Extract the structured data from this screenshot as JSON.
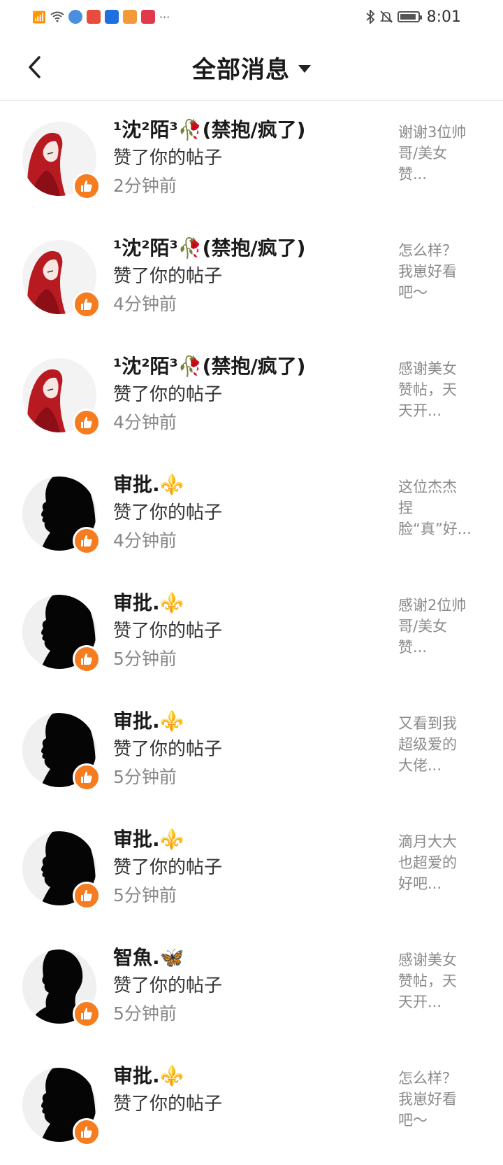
{
  "status_bar": {
    "time": "8:01",
    "left_icons": [
      "signal-off-icon",
      "wifi-icon",
      "browser-icon",
      "app-icon-1",
      "bulb-app-icon",
      "video-app-icon",
      "reader-app-icon",
      "more-dots-icon"
    ],
    "more": "···"
  },
  "header": {
    "title": "全部消息"
  },
  "messages": [
    {
      "name": "¹沈²陌³🥀(禁抱/疯了)",
      "action": "赞了你的帖子",
      "time": "2分钟前",
      "preview": "谢谢3位帅哥/美女赞...",
      "avatar": "red-hair-girl"
    },
    {
      "name": "¹沈²陌³🥀(禁抱/疯了)",
      "action": "赞了你的帖子",
      "time": "4分钟前",
      "preview": "怎么样？我崽好看吧～",
      "avatar": "red-hair-girl"
    },
    {
      "name": "¹沈²陌³🥀(禁抱/疯了)",
      "action": "赞了你的帖子",
      "time": "4分钟前",
      "preview": "感谢美女赞帖，天天开...",
      "avatar": "red-hair-girl"
    },
    {
      "name": "审批.⚜️",
      "action": "赞了你的帖子",
      "time": "4分钟前",
      "preview": "这位杰杰捏脸“真”好...",
      "avatar": "silhouette"
    },
    {
      "name": "审批.⚜️",
      "action": "赞了你的帖子",
      "time": "5分钟前",
      "preview": "感谢2位帅哥/美女赞...",
      "avatar": "silhouette"
    },
    {
      "name": "审批.⚜️",
      "action": "赞了你的帖子",
      "time": "5分钟前",
      "preview": "又看到我超级爱的大佬...",
      "avatar": "silhouette"
    },
    {
      "name": "审批.⚜️",
      "action": "赞了你的帖子",
      "time": "5分钟前",
      "preview": "滴月大大也超爱的好吧...",
      "avatar": "silhouette"
    },
    {
      "name": "智魚.🦋",
      "action": "赞了你的帖子",
      "time": "5分钟前",
      "preview": "感谢美女赞帖，天天开...",
      "avatar": "silhouette-2"
    },
    {
      "name": "审批.⚜️",
      "action": "赞了你的帖子",
      "time": "",
      "preview": "怎么样？我崽好看吧～",
      "avatar": "silhouette"
    }
  ],
  "colors": {
    "like_badge": "#f57c1f",
    "preview_text": "#8a8a8a",
    "time_text": "#888888"
  }
}
